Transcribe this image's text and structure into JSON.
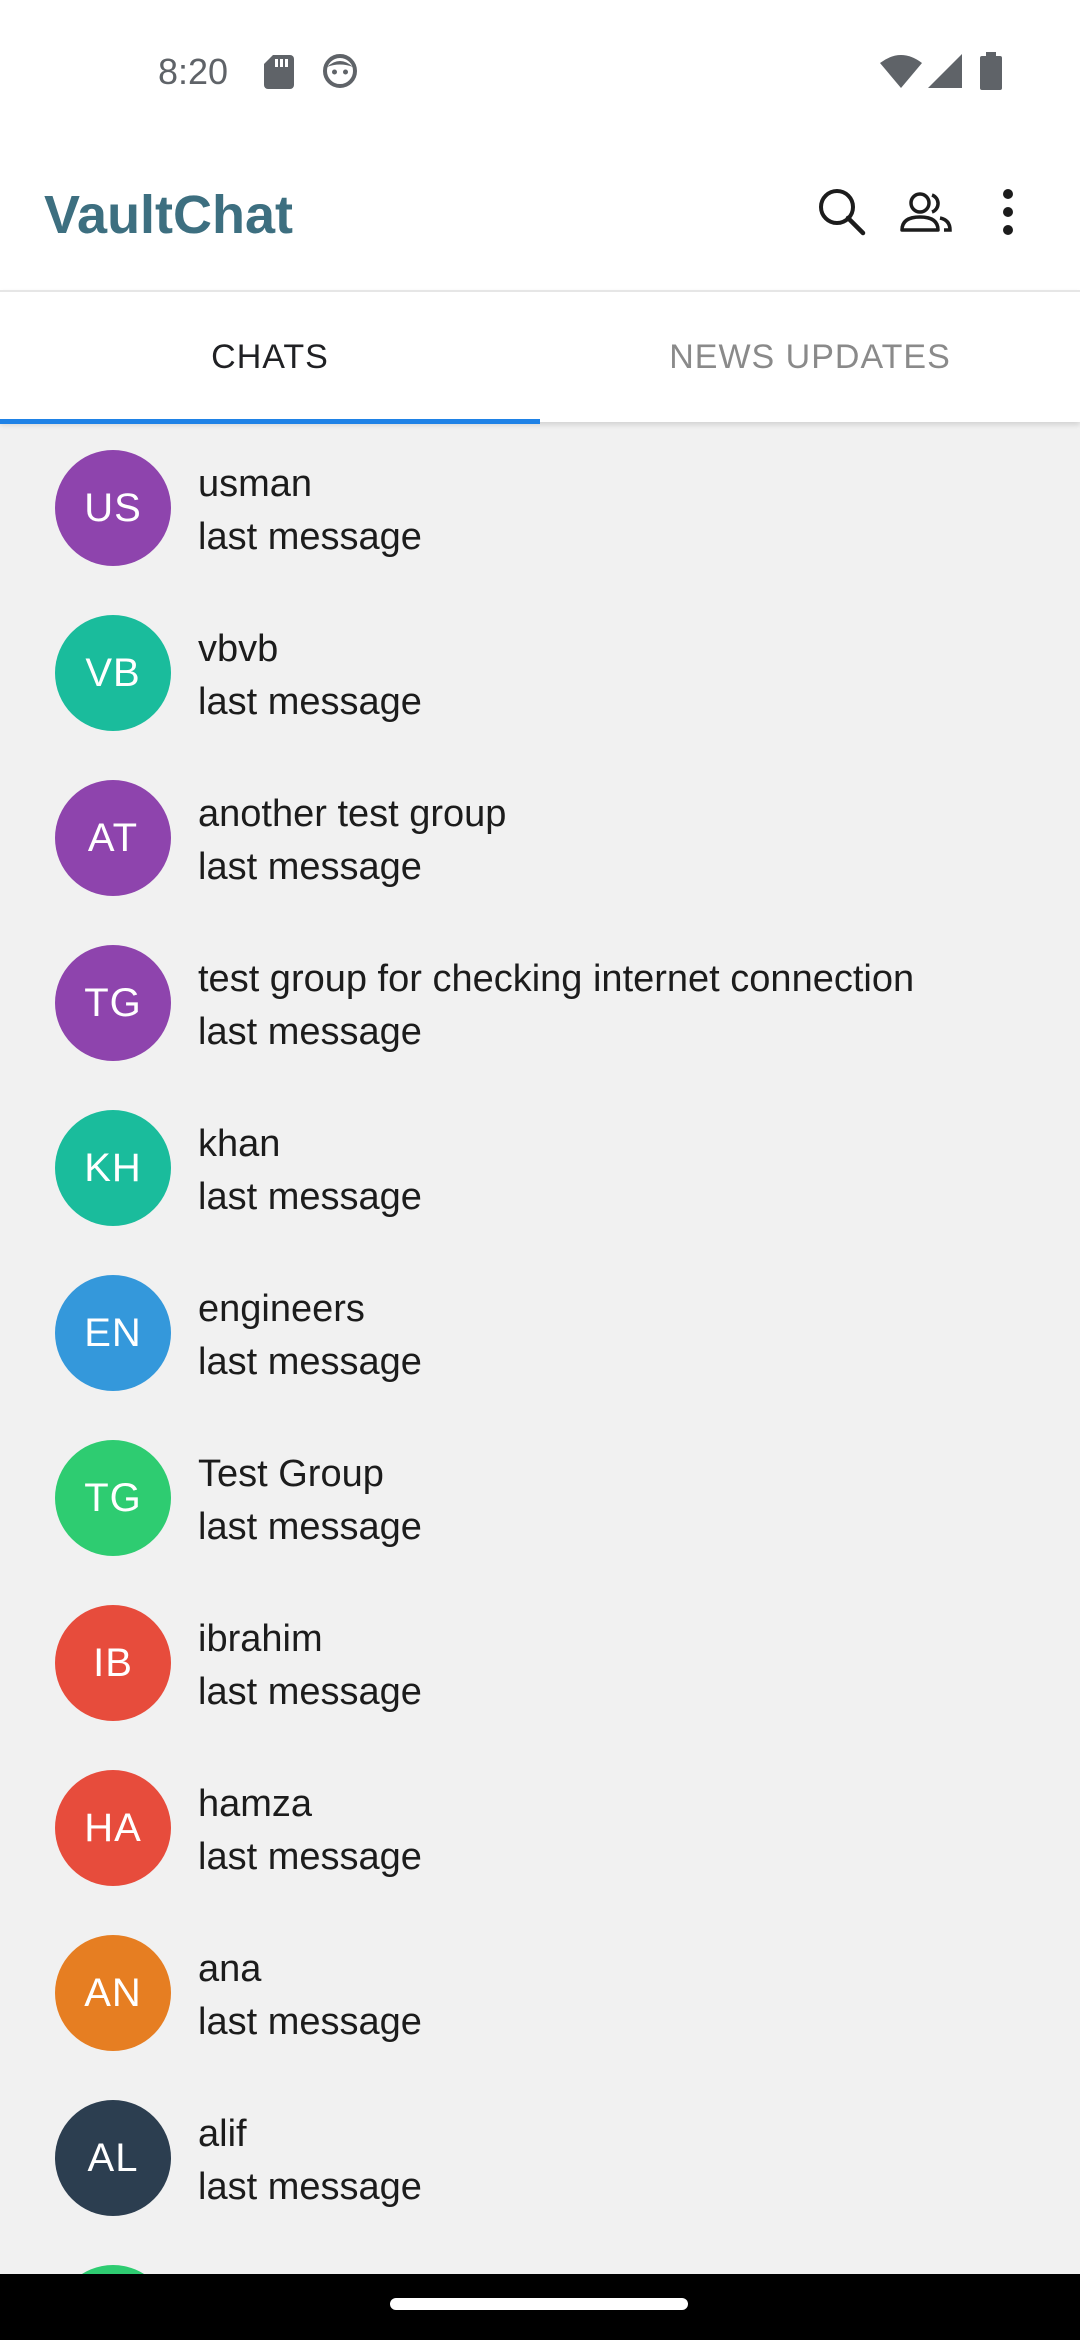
{
  "status_bar": {
    "time": "8:20",
    "icons": [
      "sd-card-icon",
      "face-icon",
      "wifi-icon",
      "signal-icon",
      "battery-icon"
    ]
  },
  "app_bar": {
    "title": "VaultChat",
    "actions": [
      "search-icon",
      "contacts-icon",
      "more-vert-icon"
    ]
  },
  "tabs": [
    {
      "label": "CHATS",
      "selected": true
    },
    {
      "label": "NEWS UPDATES",
      "selected": false
    }
  ],
  "colors": {
    "accent": "#1f82e6",
    "title": "#3d6f80"
  },
  "chats": [
    {
      "initials": "US",
      "name": "usman",
      "last": "last message",
      "color": "#8e44ad"
    },
    {
      "initials": "VB",
      "name": "vbvb",
      "last": "last message",
      "color": "#1abc9c"
    },
    {
      "initials": "AT",
      "name": "another test group",
      "last": "last message",
      "color": "#8e44ad"
    },
    {
      "initials": "TG",
      "name": "test group for checking internet connection",
      "last": "last message",
      "color": "#8e44ad"
    },
    {
      "initials": "KH",
      "name": "khan",
      "last": "last message",
      "color": "#1abc9c"
    },
    {
      "initials": "EN",
      "name": "engineers",
      "last": "last message",
      "color": "#3498db"
    },
    {
      "initials": "TG",
      "name": "Test Group",
      "last": "last message",
      "color": "#2ecc71"
    },
    {
      "initials": "IB",
      "name": "ibrahim",
      "last": "last message",
      "color": "#e74c3c"
    },
    {
      "initials": "HA",
      "name": "hamza",
      "last": "last message",
      "color": "#e74c3c"
    },
    {
      "initials": "AN",
      "name": "ana",
      "last": "last message",
      "color": "#e67e22"
    },
    {
      "initials": "AL",
      "name": "alif",
      "last": "last message",
      "color": "#2c3e50"
    },
    {
      "initials": "",
      "name": "",
      "last": "",
      "color": "#2ecc71"
    }
  ]
}
